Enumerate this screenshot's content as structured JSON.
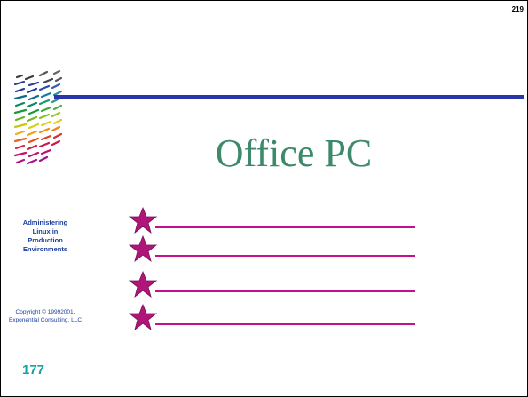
{
  "page_number": "219",
  "slide_title": "Office PC",
  "course_title": {
    "lines": [
      "Administering",
      "Linux in",
      "Production",
      "Environments"
    ]
  },
  "copyright": {
    "lines": [
      "Copyright © 19992001,",
      "Exponential Consulting, LLC"
    ]
  },
  "slide_number": "177",
  "bullets": [
    {
      "icon": "star-icon",
      "text": ""
    },
    {
      "icon": "star-icon",
      "text": ""
    },
    {
      "icon": "star-icon",
      "text": ""
    },
    {
      "icon": "star-icon",
      "text": ""
    }
  ],
  "colors": {
    "title": "#3d8a6a",
    "rule": "#2a35a8",
    "bullet_star": "#b0157a",
    "bullet_line": "#c4108a",
    "course_text": "#1a3fa0",
    "slide_number": "#14a3a0"
  }
}
